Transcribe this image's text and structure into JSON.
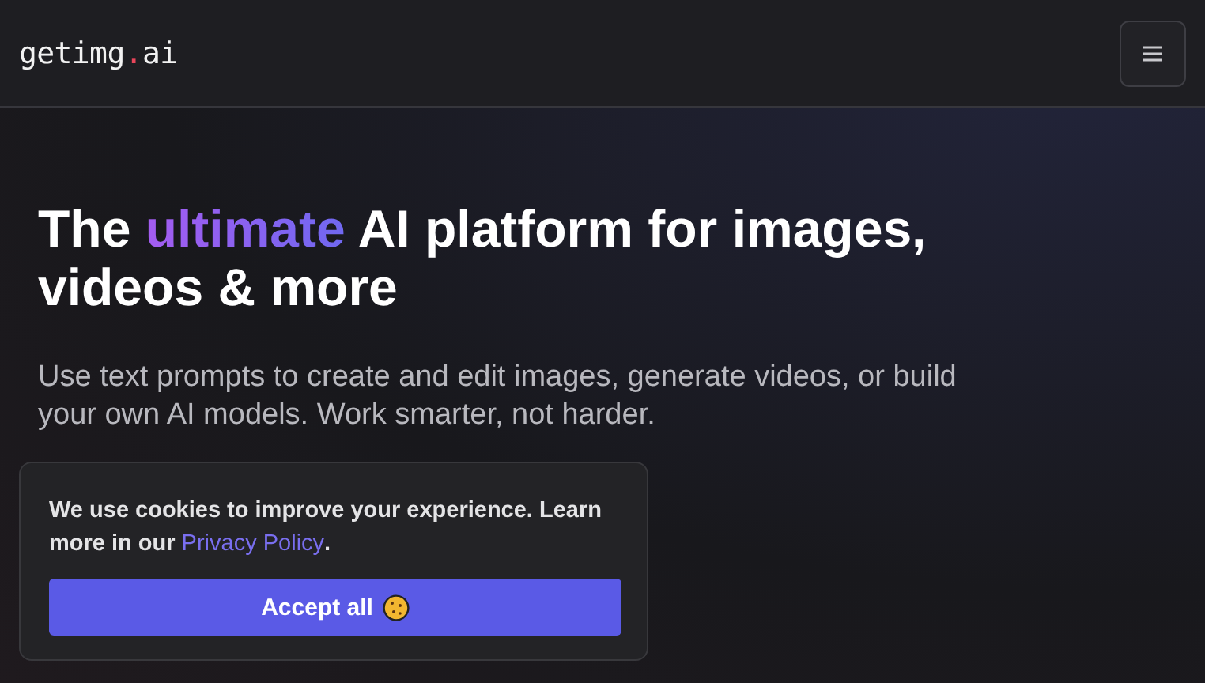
{
  "header": {
    "logo": {
      "name": "getimg",
      "dot": ".",
      "suffix": "ai"
    }
  },
  "hero": {
    "heading": {
      "before": "The ",
      "highlight": "ultimate",
      "after": " AI platform for images, videos & more"
    },
    "subtitle": "Use text prompts to create and edit images, generate videos, or build your own AI models. Work smarter, not harder."
  },
  "cookie_banner": {
    "text_before": "We use cookies to improve your experience. Learn more in our ",
    "link": "Privacy Policy",
    "text_after": ".",
    "button": "Accept all"
  }
}
